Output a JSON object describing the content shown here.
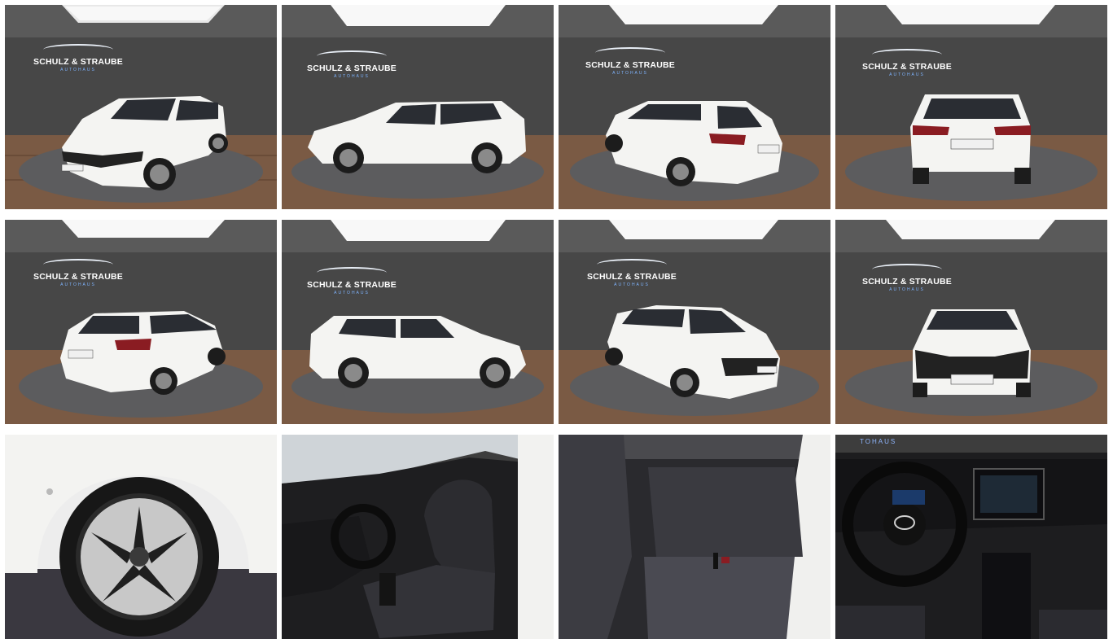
{
  "brand": {
    "name": "SCHULZ & STRAUBE",
    "sub": "AUTOHAUS",
    "strip": "TOHAUS"
  },
  "plate": {
    "text": "SCHULZ & STRAUBE"
  },
  "colors": {
    "wall": "#4a4a4a",
    "floor": "#7a5a44",
    "turntable": "#5c5c5e",
    "car_body": "#f4f4f2",
    "glass": "#2a2d33",
    "accent_blue": "#4a9cff"
  },
  "gallery": [
    {
      "id": "front-left-3q",
      "kind": "studio",
      "view": "front-left",
      "has_plate": true
    },
    {
      "id": "side-left",
      "kind": "studio",
      "view": "side-left",
      "has_plate": false
    },
    {
      "id": "rear-left-3q",
      "kind": "studio",
      "view": "rear-left",
      "has_plate": true
    },
    {
      "id": "rear",
      "kind": "studio",
      "view": "rear",
      "has_plate": true
    },
    {
      "id": "rear-right-3q",
      "kind": "studio",
      "view": "rear-right",
      "has_plate": true
    },
    {
      "id": "side-right",
      "kind": "studio",
      "view": "side-right",
      "has_plate": false
    },
    {
      "id": "front-right-3q",
      "kind": "studio",
      "view": "front-right",
      "has_plate": true
    },
    {
      "id": "front",
      "kind": "studio",
      "view": "front",
      "has_plate": true
    },
    {
      "id": "wheel",
      "kind": "detail",
      "view": "wheel-closeup",
      "has_plate": false
    },
    {
      "id": "front-seats",
      "kind": "detail",
      "view": "driver-door-open",
      "has_plate": false
    },
    {
      "id": "rear-seats",
      "kind": "detail",
      "view": "rear-bench",
      "has_plate": false
    },
    {
      "id": "cockpit",
      "kind": "detail",
      "view": "dashboard",
      "has_plate": false
    }
  ]
}
